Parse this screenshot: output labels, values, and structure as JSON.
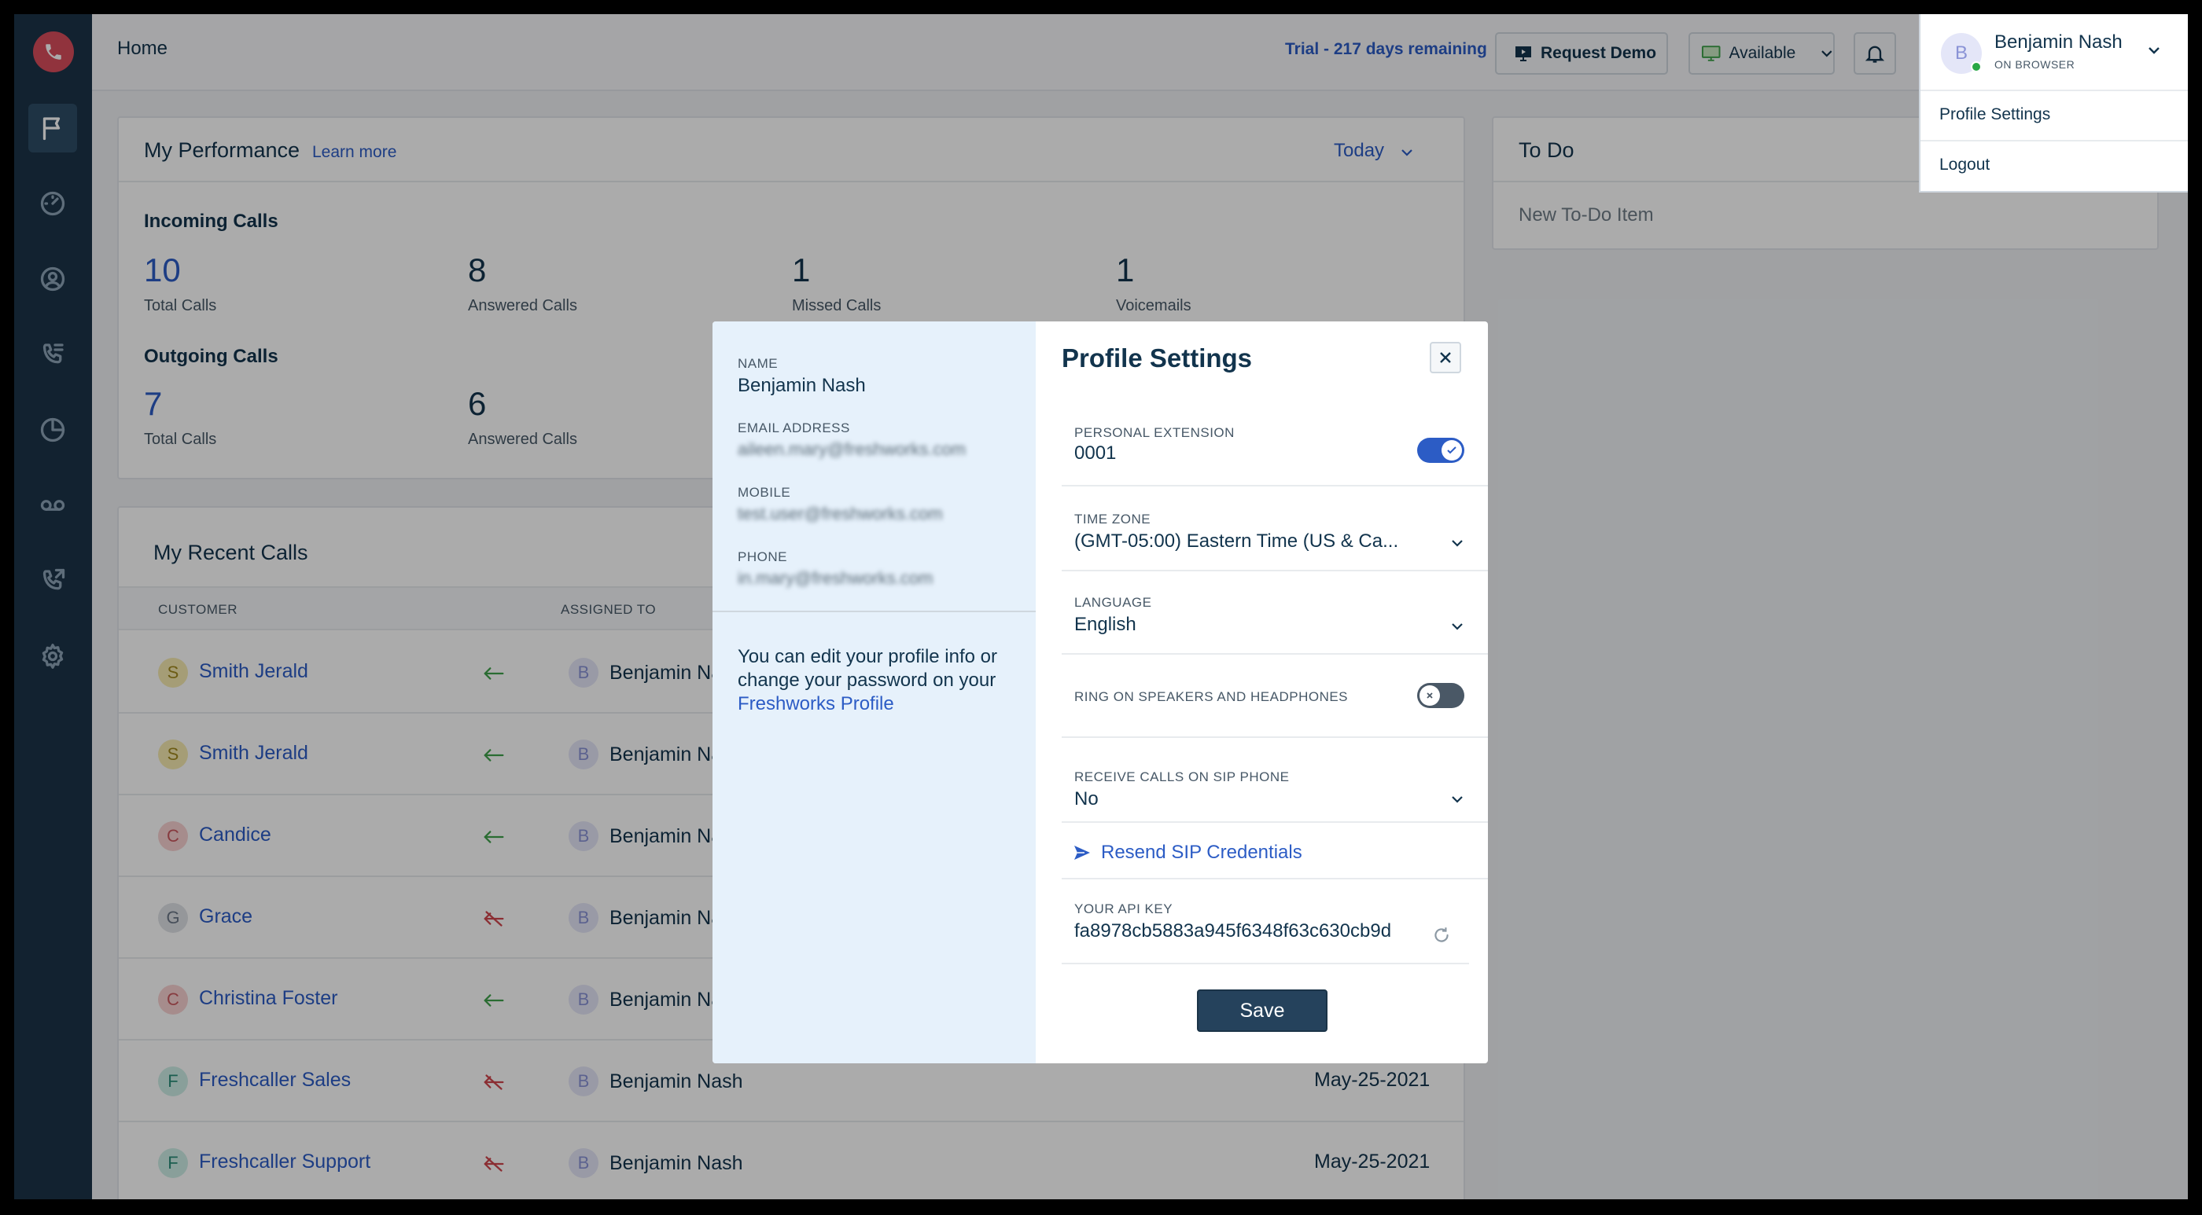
{
  "topbar": {
    "title": "Home",
    "trial": "Trial - 217 days remaining",
    "request_demo": "Request Demo",
    "status": "Available"
  },
  "performance": {
    "title": "My Performance",
    "learn_more": "Learn more",
    "period": "Today",
    "incoming": {
      "title": "Incoming Calls",
      "stats": [
        {
          "value": "10",
          "label": "Total Calls"
        },
        {
          "value": "8",
          "label": "Answered Calls"
        },
        {
          "value": "1",
          "label": "Missed Calls"
        },
        {
          "value": "1",
          "label": "Voicemails"
        }
      ]
    },
    "outgoing": {
      "title": "Outgoing Calls",
      "stats": [
        {
          "value": "7",
          "label": "Total Calls"
        },
        {
          "value": "6",
          "label": "Answered Calls"
        }
      ]
    }
  },
  "todo": {
    "title": "To Do",
    "new_item": "New To-Do Item"
  },
  "recent": {
    "title": "My Recent Calls",
    "columns": [
      "CUSTOMER",
      "ASSIGNED TO"
    ],
    "rows": [
      {
        "initial": "S",
        "customer": "Smith Jerald",
        "direction": "incoming",
        "agent_initial": "B",
        "agent": "Benjamin Nash",
        "date": ""
      },
      {
        "initial": "S",
        "customer": "Smith Jerald",
        "direction": "incoming",
        "agent_initial": "B",
        "agent": "Benjamin Nash",
        "date": ""
      },
      {
        "initial": "C",
        "customer": "Candice",
        "direction": "incoming",
        "agent_initial": "B",
        "agent": "Benjamin Nash",
        "date": ""
      },
      {
        "initial": "G",
        "customer": "Grace",
        "direction": "missed",
        "agent_initial": "B",
        "agent": "Benjamin Nash",
        "date": ""
      },
      {
        "initial": "C",
        "customer": "Christina Foster",
        "direction": "incoming",
        "agent_initial": "B",
        "agent": "Benjamin Nash",
        "date": ""
      },
      {
        "initial": "F",
        "customer": "Freshcaller Sales",
        "direction": "missed",
        "agent_initial": "B",
        "agent": "Benjamin Nash",
        "date": "May-25-2021"
      },
      {
        "initial": "F",
        "customer": "Freshcaller Support",
        "direction": "missed",
        "agent_initial": "B",
        "agent": "Benjamin Nash",
        "date": "May-25-2021"
      }
    ]
  },
  "modal": {
    "name_label": "NAME",
    "name": "Benjamin Nash",
    "email_label": "EMAIL ADDRESS",
    "email": "aileen.mary@freshworks.com",
    "mobile_label": "MOBILE",
    "mobile": "test.user@freshworks.com",
    "phone_label": "PHONE",
    "phone": "in.mary@freshworks.com",
    "note": "You can edit your profile info or change your password on your",
    "note_link": "Freshworks Profile",
    "title": "Profile Settings",
    "extension_label": "PERSONAL EXTENSION",
    "extension": "0001",
    "timezone_label": "TIME ZONE",
    "timezone": "(GMT-05:00) Eastern Time (US & Ca...",
    "language_label": "LANGUAGE",
    "language": "English",
    "ring_label": "RING ON SPEAKERS AND HEADPHONES",
    "sip_label": "RECEIVE CALLS ON SIP PHONE",
    "sip": "No",
    "resend": "Resend SIP Credentials",
    "api_label": "YOUR API KEY",
    "api_key": "fa8978cb5883a945f6348f63c630cb9d",
    "save": "Save",
    "extension_enabled": true,
    "ring_enabled": false
  },
  "profile_menu": {
    "initial": "B",
    "name": "Benjamin Nash",
    "subtitle": "ON BROWSER",
    "items": [
      "Profile Settings",
      "Logout"
    ]
  },
  "colors": {
    "sidebar": "#1b3448",
    "accent": "#2c5cc5",
    "toggle_on": "#2c5cc5",
    "toggle_off": "#4a5866",
    "incoming_arrow": "#3fa14b",
    "missed_arrow": "#d0454c"
  }
}
